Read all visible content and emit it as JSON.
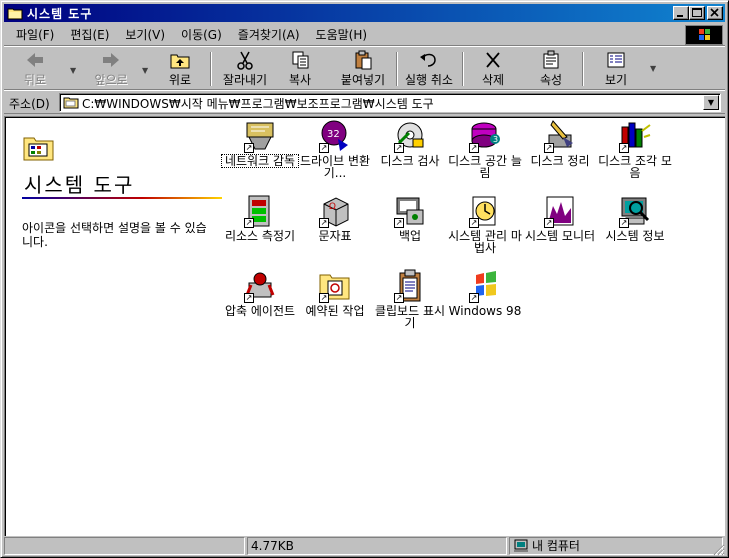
{
  "window": {
    "title": "시스템 도구"
  },
  "menubar": {
    "items": [
      "파일(F)",
      "편집(E)",
      "보기(V)",
      "이동(G)",
      "즐겨찾기(A)",
      "도움말(H)"
    ]
  },
  "toolbar": {
    "back": "뒤로",
    "forward": "앞으로",
    "up": "위로",
    "cut": "잘라내기",
    "copy": "복사",
    "paste": "붙여넣기",
    "undo": "실행 취소",
    "delete": "삭제",
    "properties": "속성",
    "views": "보기"
  },
  "address": {
    "label": "주소(D)",
    "value": "C:₩WINDOWS₩시작 메뉴₩프로그램₩보조프로그램₩시스템 도구"
  },
  "sidebar": {
    "title": "시스템 도구",
    "description": "아이콘을 선택하면 설명을 볼 수 있습니다."
  },
  "items": [
    {
      "label": "네트워크 감독"
    },
    {
      "label": "드라이브 변환기..."
    },
    {
      "label": "디스크 검사"
    },
    {
      "label": "디스크 공간 늘림"
    },
    {
      "label": "디스크 정리"
    },
    {
      "label": "디스크 조각 모음"
    },
    {
      "label": "리소스 측정기"
    },
    {
      "label": "문자표"
    },
    {
      "label": "백업"
    },
    {
      "label": "시스템 관리 마법사"
    },
    {
      "label": "시스템 모니터"
    },
    {
      "label": "시스템 정보"
    },
    {
      "label": "압축 에이전트"
    },
    {
      "label": "예약된 작업"
    },
    {
      "label": "클립보드 표시기"
    },
    {
      "label": "Windows 98"
    }
  ],
  "statusbar": {
    "size": "4.77KB",
    "location": "내 컴퓨터"
  },
  "colors": {
    "titlebar_start": "#000080",
    "titlebar_end": "#1084d0",
    "face": "#c0c0c0"
  }
}
